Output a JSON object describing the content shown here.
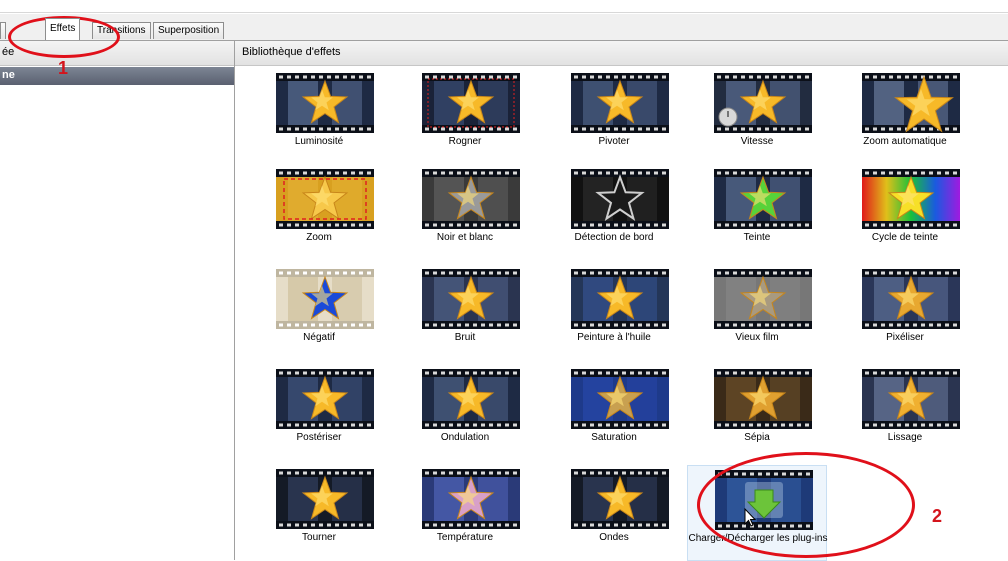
{
  "tabs": [
    {
      "label": "Effets",
      "active": true
    },
    {
      "label": "Transitions",
      "active": false
    },
    {
      "label": "Superposition",
      "active": false
    }
  ],
  "left_panel": {
    "header_text": "ée",
    "selected_item": "ne"
  },
  "library": {
    "title": "Bibliothèque d'effets",
    "effects": [
      {
        "label": "Luminosité"
      },
      {
        "label": "Rogner"
      },
      {
        "label": "Pivoter"
      },
      {
        "label": "Vitesse"
      },
      {
        "label": "Zoom automatique"
      },
      {
        "label": "Zoom"
      },
      {
        "label": "Noir et blanc"
      },
      {
        "label": "Détection de bord"
      },
      {
        "label": "Teinte"
      },
      {
        "label": "Cycle de teinte"
      },
      {
        "label": "Négatif"
      },
      {
        "label": "Bruit"
      },
      {
        "label": "Peinture à l'huile"
      },
      {
        "label": "Vieux film"
      },
      {
        "label": "Pixéliser"
      },
      {
        "label": "Postériser"
      },
      {
        "label": "Ondulation"
      },
      {
        "label": "Saturation"
      },
      {
        "label": "Sépia"
      },
      {
        "label": "Lissage"
      },
      {
        "label": "Tourner"
      },
      {
        "label": "Température"
      },
      {
        "label": "Ondes"
      },
      {
        "label": "Charger/Décharger les plug-ins"
      }
    ]
  },
  "annotations": {
    "tab_marker": "1",
    "plugin_marker": "2"
  },
  "colors": {
    "annotation_red": "#e0101a",
    "selection_bar": "#5a6070",
    "star_gold": "#f7b928",
    "film_dark": "#141a26"
  }
}
